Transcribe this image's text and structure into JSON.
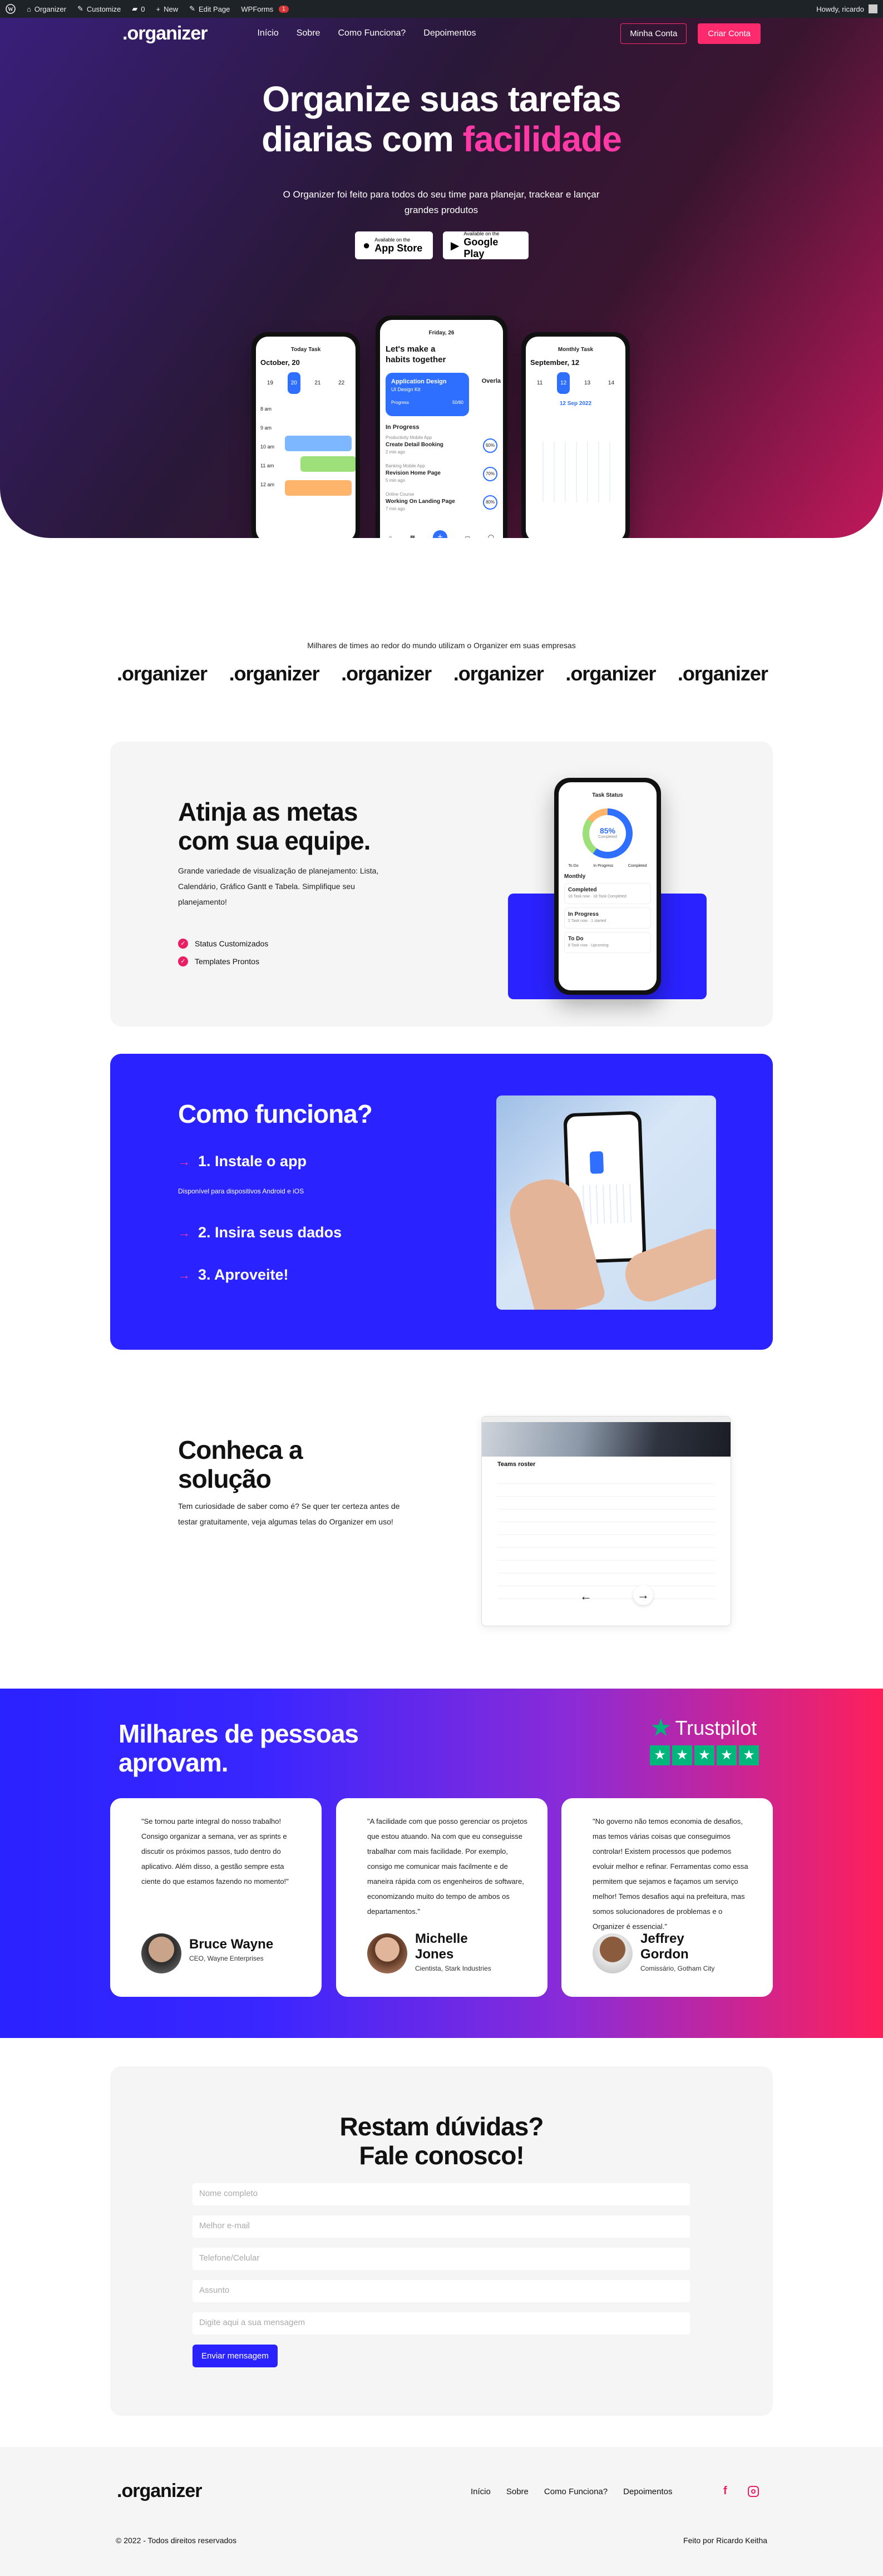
{
  "adminbar": {
    "site": "Organizer",
    "customize": "Customize",
    "comments": "0",
    "new": "New",
    "edit": "Edit Page",
    "wpforms": "WPForms",
    "wpforms_badge": "1",
    "howdy": "Howdy, ricardo"
  },
  "nav": {
    "logo": ".organizer",
    "links": [
      "Início",
      "Sobre",
      "Como Funciona?",
      "Depoimentos"
    ],
    "login": "Minha Conta",
    "signup": "Criar Conta"
  },
  "hero": {
    "title_1": "Organize suas tarefas",
    "title_2a": "diarias com ",
    "title_2b": "facilidade",
    "subtitle": "O Organizer foi feito para todos do seu time para planejar, trackear e lançar grandes produtos",
    "appstore_small": "Available on the",
    "appstore_big": "App Store",
    "gplay_small": "Available on the",
    "gplay_big": "Google Play"
  },
  "phones": {
    "left": {
      "title": "Today Task",
      "month": "October, 20",
      "days": [
        "19",
        "20",
        "21",
        "22"
      ],
      "times": [
        "8 am",
        "9 am",
        "10 am",
        "11 am",
        "12 am"
      ]
    },
    "center": {
      "date": "Friday, 26",
      "heading_1": "Let's make a",
      "heading_2": "habits together",
      "card_title": "Application Design",
      "card_sub": "UI Design Kit",
      "card_progress": "Progress",
      "card_pct": "50/80",
      "card_next": "Overla",
      "in_progress": "In Progress",
      "tasks": [
        {
          "small": "Productivity Mobile App",
          "title": "Create Detail Booking",
          "meta": "2 min ago",
          "pct": "60%"
        },
        {
          "small": "Banking Mobile App",
          "title": "Revision Home Page",
          "meta": "5 min ago",
          "pct": "70%"
        },
        {
          "small": "Online Course",
          "title": "Working On Landing Page",
          "meta": "7 min ago",
          "pct": "80%"
        }
      ]
    },
    "right": {
      "title": "Monthly Task",
      "month": "September, 12",
      "days": [
        "11",
        "12",
        "13",
        "14"
      ],
      "cal_title": "12 Sep 2022"
    }
  },
  "trusted": {
    "title": "Milhares de times ao redor do mundo utilizam o Organizer em suas empresas",
    "logos": [
      ".organizer",
      ".organizer",
      ".organizer",
      ".organizer",
      ".organizer",
      ".organizer"
    ]
  },
  "goals": {
    "title_1": "Atinja as metas",
    "title_2": "com sua equipe.",
    "text": "Grande variedade de visualização de planejamento: Lista, Calendário, Gráfico Gantt e Tabela. Simplifique seu planejamento!",
    "checks": [
      "Status Customizados",
      "Templates Prontos"
    ],
    "phone": {
      "title": "Task Status",
      "pct": "85%",
      "pct_label": "Completed",
      "legend": [
        "To Do",
        "In Progress",
        "Completed"
      ],
      "section": "Monthly",
      "items": [
        {
          "title": "Completed",
          "sub": "18 Task now · 18 Task Completed"
        },
        {
          "title": "In Progress",
          "sub": "2 Task now · 1 started"
        },
        {
          "title": "To Do",
          "sub": "8 Task now · Upcoming"
        }
      ]
    }
  },
  "how": {
    "title": "Como funciona?",
    "step1": "1. Instale o app",
    "step1_sub": "Disponível para dispositivos Android e iOS",
    "step2": "2. Insira seus dados",
    "step3": "3. Aproveite!"
  },
  "solution": {
    "title_1": "Conheca a",
    "title_2": "solução",
    "text": "Tem curiosidade de saber como é? Se quer ter certeza antes de testar gratuitamente, veja algumas telas do Organizer em uso!",
    "shot_title": "Teams roster"
  },
  "testimonials": {
    "title_1": "Milhares de pessoas",
    "title_2": "aprovam.",
    "trustpilot": "Trustpilot",
    "items": [
      {
        "quote": "\"Se tornou parte integral do nosso trabalho! Consigo organizar a semana, ver as sprints e discutir os próximos passos, tudo dentro do aplicativo. Além disso, a gestão sempre esta ciente do que estamos fazendo no momento!\"",
        "name_1": "Bruce Wayne",
        "name_2": "",
        "role": "CEO, Wayne Enterprises"
      },
      {
        "quote": "\"A facilidade com que posso gerenciar os projetos que estou atuando. Na com que eu conseguisse trabalhar com mais facilidade. Por exemplo, consigo me comunicar mais facilmente e de maneira rápida com os engenheiros de software, economizando muito do tempo de ambos os departamentos.\"",
        "name_1": "Michelle",
        "name_2": "Jones",
        "role": "Cientista, Stark Industries"
      },
      {
        "quote": "\"No governo não temos economia de desafios, mas temos várias coisas que conseguimos controlar! Existem processos que podemos evoluir melhor e refinar. Ferramentas como essa permitem que sejamos e façamos um serviço melhor! Temos desafios aqui na prefeitura, mas somos solucionadores de problemas e o Organizer é essencial.\"",
        "name_1": "Jeffrey",
        "name_2": "Gordon",
        "role": "Comissário, Gotham City"
      }
    ]
  },
  "contact": {
    "title_1": "Restam dúvidas?",
    "title_2": "Fale conosco!",
    "placeholders": [
      "Nome completo",
      "Melhor e-mail",
      "Telefone/Celular",
      "Assunto",
      "Digite aqui a sua mensagem"
    ],
    "submit": "Enviar mensagem"
  },
  "footer": {
    "logo": ".organizer",
    "links": [
      "Início",
      "Sobre",
      "Como Funciona?",
      "Depoimentos"
    ],
    "copyright": "© 2022 - Todos direitos reservados",
    "credit": "Feito por Ricardo Keitha"
  },
  "colors": {
    "brand_pink": "#ff2a6d",
    "brand_blue": "#2a22ff",
    "accent_blue": "#2f6fff"
  }
}
